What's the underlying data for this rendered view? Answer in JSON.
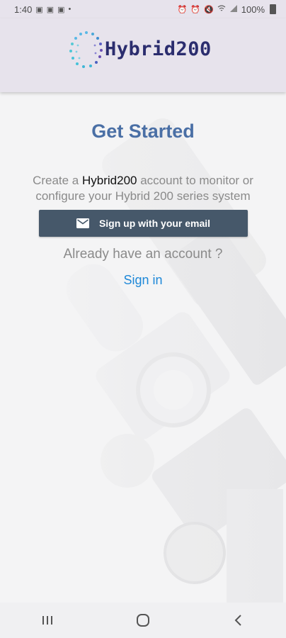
{
  "status_bar": {
    "time": "1:40",
    "battery": "100%",
    "left_icons": [
      "image-icon",
      "image-icon",
      "image-icon",
      "dot-icon"
    ],
    "right_icons": [
      "alarm-icon",
      "alarm-icon",
      "mute-icon",
      "wifi-icon",
      "signal-icon",
      "battery-icon"
    ]
  },
  "header": {
    "logo_text": "Hybrid200",
    "logo_colors": [
      "#2b2d6e",
      "#3fb6d6",
      "#6a4fb3"
    ]
  },
  "main": {
    "title": "Get Started",
    "description": {
      "prefix": "Create a ",
      "brand": "Hybrid200",
      "suffix": " account to monitor or configure your Hybrid 200 series system"
    },
    "signup_button_label": "Sign up with your email",
    "already_text": "Already have an account ?",
    "signin_link": "Sign in"
  },
  "nav_bar": {
    "buttons": [
      "recent-apps",
      "home",
      "back"
    ]
  },
  "colors": {
    "title": "#4a6fa5",
    "button_bg": "#46586a",
    "link": "#1e88d8",
    "header_bg": "#e7e3ec"
  }
}
